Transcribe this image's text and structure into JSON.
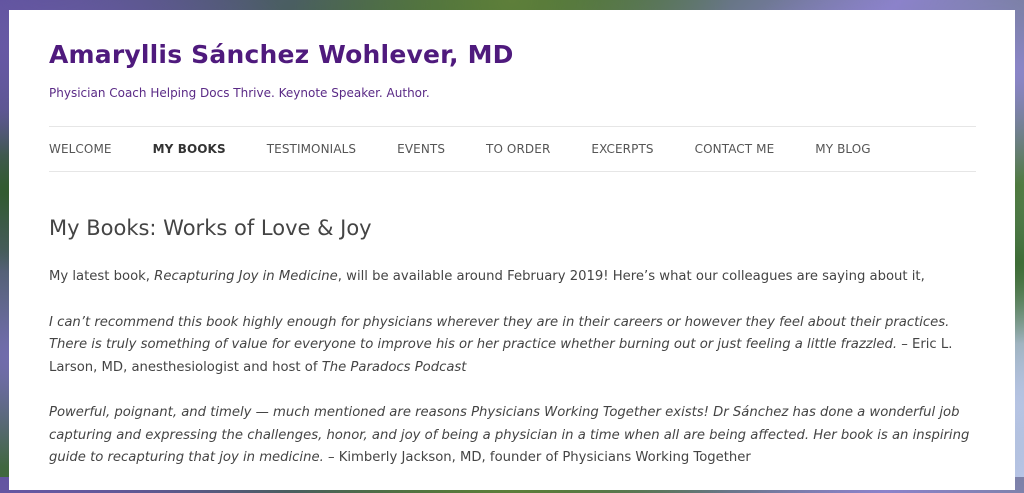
{
  "site": {
    "title": "Amaryllis Sánchez Wohlever, MD",
    "tagline": "Physician Coach Helping Docs Thrive. Keynote Speaker. Author."
  },
  "nav": {
    "items": [
      {
        "label": "WELCOME"
      },
      {
        "label": "MY BOOKS",
        "current": true
      },
      {
        "label": "TESTIMONIALS"
      },
      {
        "label": "EVENTS"
      },
      {
        "label": "TO ORDER"
      },
      {
        "label": "EXCERPTS"
      },
      {
        "label": "CONTACT ME"
      },
      {
        "label": "MY BLOG"
      }
    ]
  },
  "article": {
    "title": "My Books: Works of Love & Joy",
    "intro": {
      "before": "My latest book, ",
      "book_title": "Recapturing Joy in Medicine",
      "after": ", will be available around February 2019! Here’s what our colleagues are saying about it,"
    },
    "quote1": {
      "text": "I can’t recommend this book highly enough for physicians wherever they are in their careers or however they feel about their practices. There is truly something of value for everyone to improve his or her practice whether burning out or just feeling a little frazzled.",
      "attribution": " – Eric L. Larson, MD, anesthesiologist and host of ",
      "podcast": "The Paradocs Podcast"
    },
    "quote2": {
      "text": "Powerful, poignant, and timely — much mentioned are reasons Physicians Working Together exists! Dr Sánchez has done a wonderful job capturing and expressing the challenges, honor, and joy of being a physician in a time when all are being affected. Her book is an inspiring guide to recapturing that joy in medicine.",
      "attribution": " – Kimberly Jackson, MD, founder of Physicians Working Together"
    }
  },
  "colors": {
    "title": "#4f1a7d",
    "tagline": "#5a2a86",
    "text": "#444444"
  }
}
